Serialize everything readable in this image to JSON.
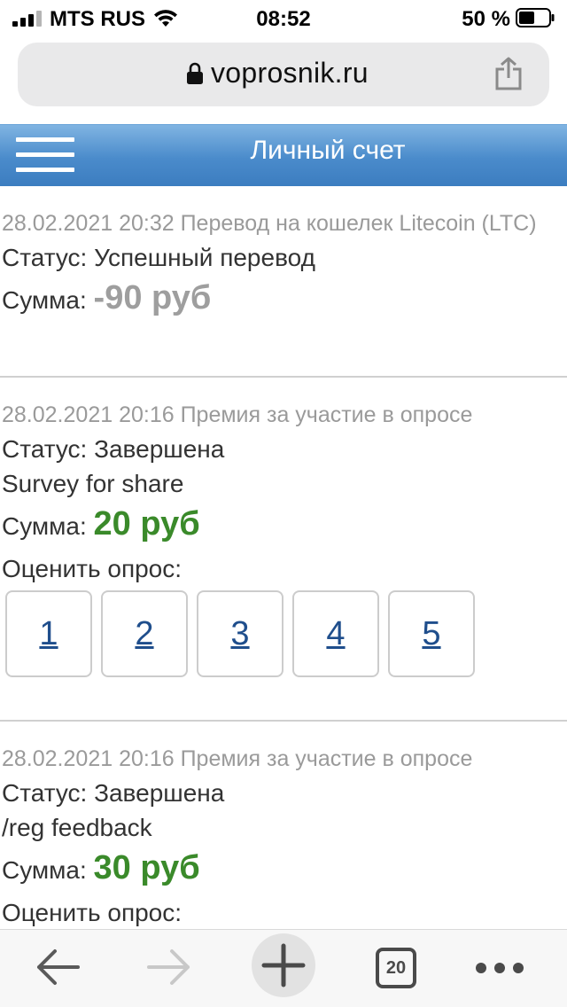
{
  "status_bar": {
    "carrier": "MTS RUS",
    "time": "08:52",
    "battery": "50 %",
    "icons": [
      "signal-icon",
      "wifi-icon",
      "battery-icon"
    ]
  },
  "browser": {
    "url": "voprosnik.ru",
    "icons": [
      "lock-icon",
      "share-icon"
    ]
  },
  "header": {
    "title": "Личный счет",
    "icon": "hamburger-menu-icon",
    "color": "#4a8bcb"
  },
  "entries": [
    {
      "datetime": "28.02.2021 20:32 Перевод на кошелек Litecoin (LTC)",
      "status": "Статус: Успешный перевод",
      "sum_label": "Сумма:",
      "amount": "-90 руб"
    },
    {
      "datetime": "28.02.2021 20:16 Премия за участие в опросе",
      "status": "Статус: Завершена",
      "note": "Survey for share",
      "sum_label": "Сумма:",
      "amount": "20 руб",
      "rate_label": "Оценить опрос:",
      "rate_options": [
        "1",
        "2",
        "3",
        "4",
        "5"
      ]
    },
    {
      "datetime": "28.02.2021 20:16 Премия за участие в опросе",
      "status": "Статус: Завершена",
      "note": "/reg feedback",
      "sum_label": "Сумма:",
      "amount": "30 руб",
      "rate_label": "Оценить опрос:"
    }
  ],
  "colors": {
    "amount_negative": "#9e9e9e",
    "amount_positive": "#3a8a2a",
    "link": "#1f4e8c"
  },
  "toolbar": {
    "tabs_count": "20",
    "icons": [
      "back-arrow-icon",
      "forward-arrow-icon",
      "plus-icon",
      "tabs-icon",
      "more-dots-icon"
    ]
  }
}
